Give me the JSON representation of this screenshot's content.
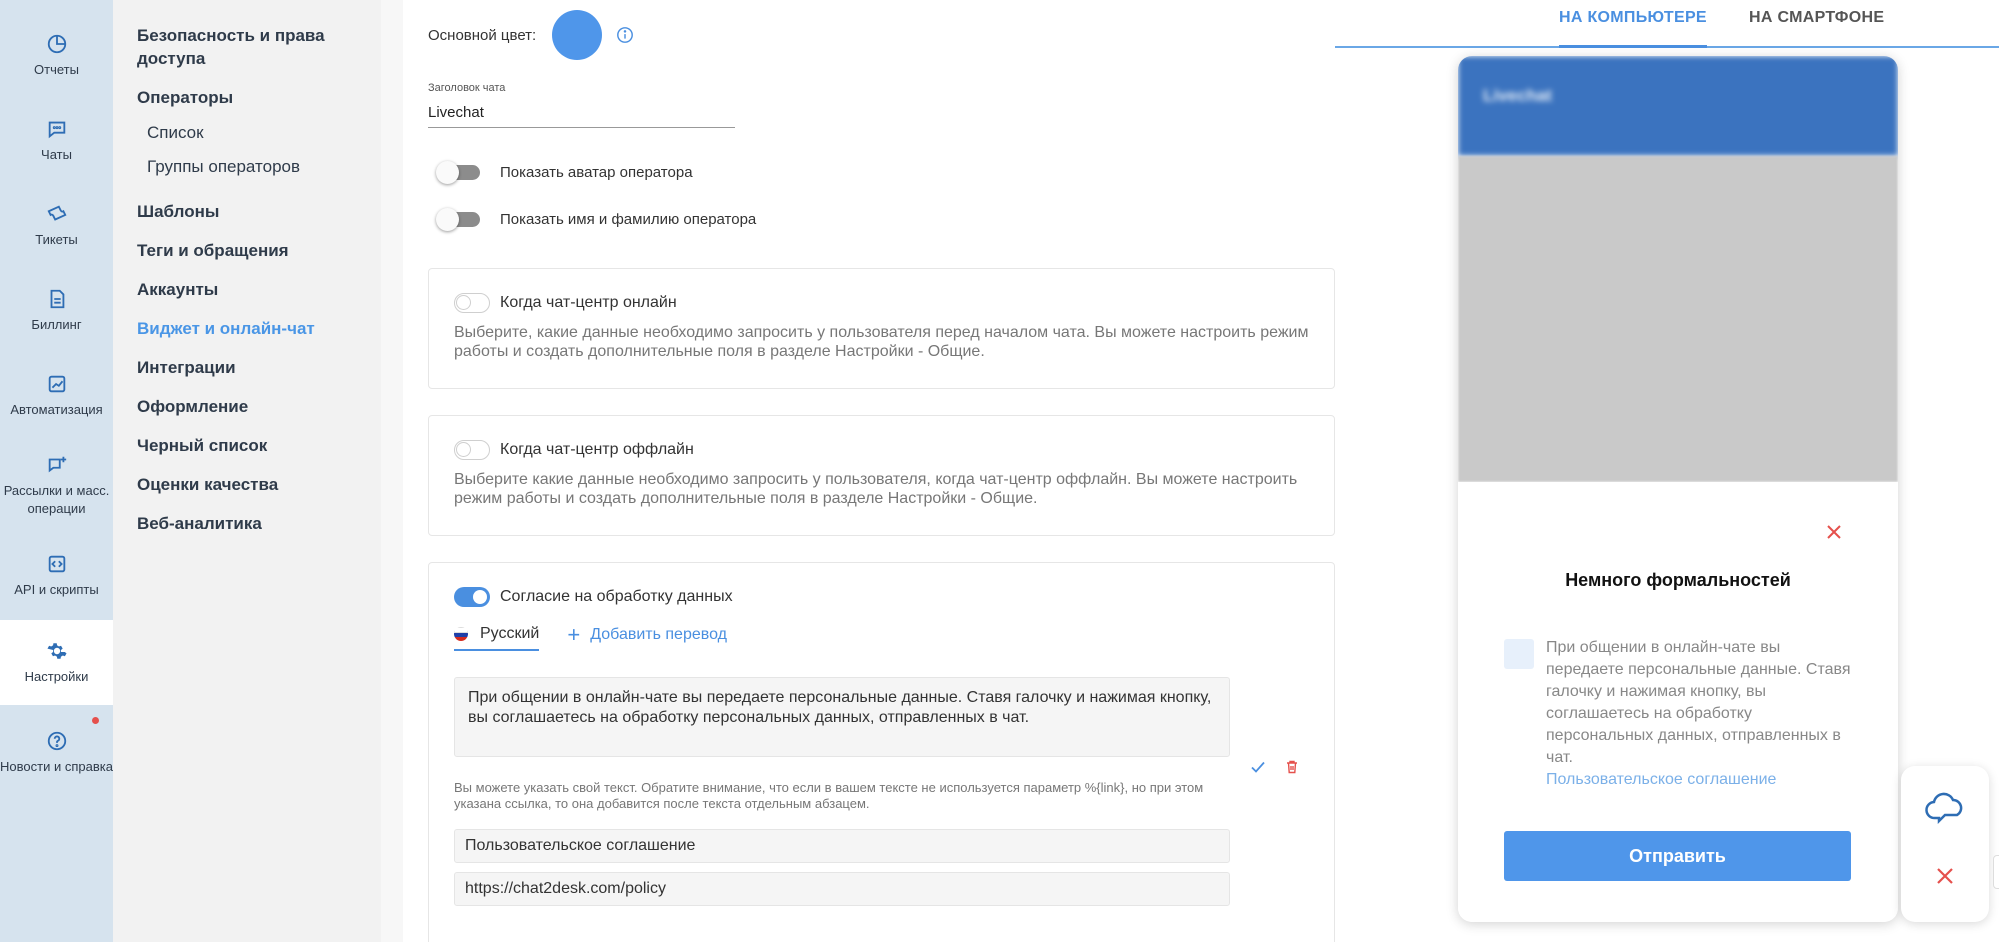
{
  "rail": [
    {
      "label": "Отчеты",
      "icon": "pie-chart-icon"
    },
    {
      "label": "Чаты",
      "icon": "chat-bubble-icon"
    },
    {
      "label": "Тикеты",
      "icon": "ticket-icon"
    },
    {
      "label": "Биллинг",
      "icon": "invoice-icon"
    },
    {
      "label": "Автоматизация",
      "icon": "trend-icon"
    },
    {
      "label": "Рассылки и масс. операции",
      "icon": "broadcast-icon"
    },
    {
      "label": "API и скрипты",
      "icon": "code-icon"
    },
    {
      "label": "Настройки",
      "icon": "gear-icon"
    },
    {
      "label": "Новости и справка",
      "icon": "help-icon"
    }
  ],
  "nav": {
    "security": "Безопасность и права доступа",
    "operators": "Операторы",
    "operators_list": "Список",
    "operators_groups": "Группы операторов",
    "templates": "Шаблоны",
    "tags": "Теги и обращения",
    "accounts": "Аккаунты",
    "widget": "Виджет и онлайн-чат",
    "integrations": "Интеграции",
    "design": "Оформление",
    "blacklist": "Черный список",
    "ratings": "Оценки качества",
    "analytics": "Веб-аналитика"
  },
  "form": {
    "main_color_label": "Основной цвет:",
    "main_color": "#4f96ea",
    "chat_title_label": "Заголовок чата",
    "chat_title_value": "Livechat",
    "show_avatar": "Показать аватар оператора",
    "show_name": "Показать имя и фамилию оператора",
    "online_title": "Когда чат-центр онлайн",
    "online_desc": "Выберите, какие данные необходимо запросить у пользователя перед началом чата. Вы можете настроить режим работы и создать дополнительные поля в разделе Настройки - Общие.",
    "offline_title": "Когда чат-центр оффлайн",
    "offline_desc": "Выберите какие данные необходимо запросить у пользователя, когда чат-центр оффлайн. Вы можете настроить режим работы и создать дополнительные поля в разделе Настройки - Общие.",
    "consent_title": "Согласие на обработку данных",
    "lang_ru": "Русский",
    "add_translation": "Добавить перевод",
    "consent_text": "При общении в онлайн-чате вы передаете персональные данные. Ставя галочку и нажимая кнопку, вы соглашаетесь на обработку персональных данных, отправленных в чат.",
    "consent_hint": "Вы можете указать свой текст. Обратите внимание, что если в вашем тексте не используется параметр %{link}, но при этом указана ссылка, то она добавится после текста отдельным абзацем.",
    "link_text": "Пользовательское соглашение",
    "link_url": "https://chat2desk.com/policy"
  },
  "preview": {
    "tab_desktop": "НА КОМПЬЮТЕРЕ",
    "tab_mobile": "НА СМАРТФОНЕ",
    "header_title": "Livechat",
    "modal_title": "Немного формальностей",
    "modal_text": "При общении в онлайн-чате вы передаете персональные данные. Ставя галочку и нажимая кнопку, вы соглашаетесь на обработку персональных данных, отправленных в чат.",
    "modal_link": "Пользовательское соглашение",
    "send_button": "Отправить"
  },
  "colors": {
    "accent": "#4a8fe0",
    "close": "#e5504c"
  }
}
